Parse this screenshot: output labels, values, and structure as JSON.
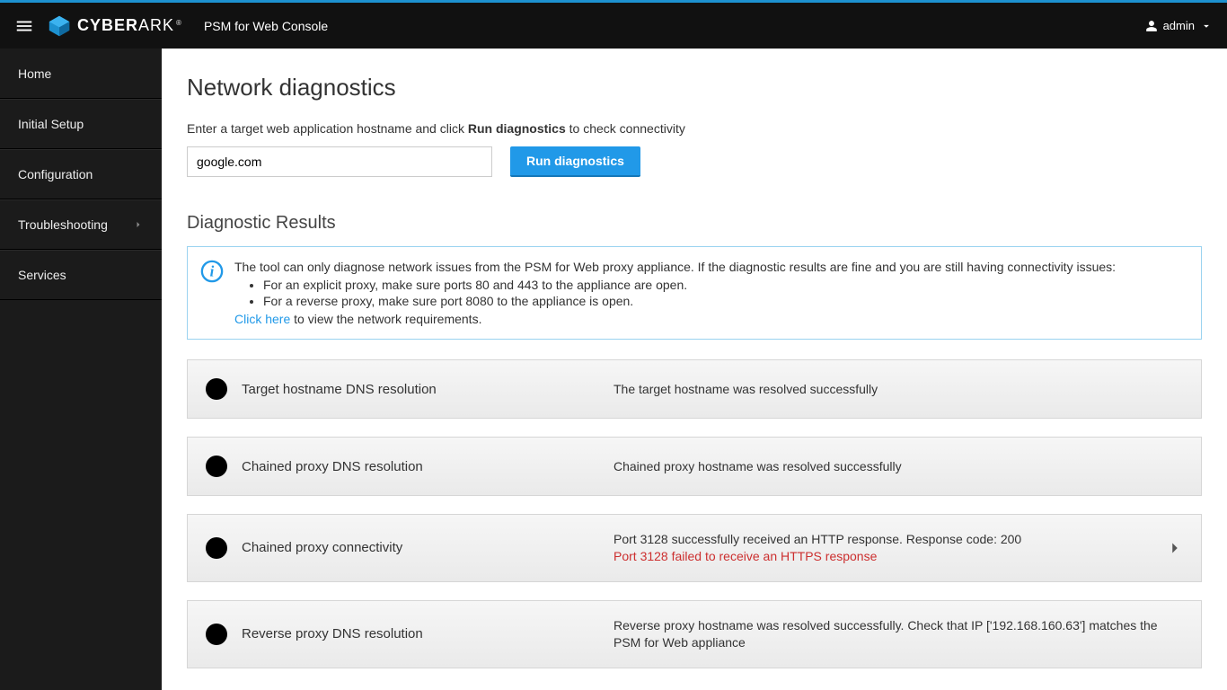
{
  "header": {
    "brand_cyber": "CYBER",
    "brand_ark": "ARK",
    "app_name": "PSM for Web Console",
    "user_label": "admin"
  },
  "sidebar": {
    "items": [
      {
        "label": "Home",
        "expandable": false
      },
      {
        "label": "Initial Setup",
        "expandable": false
      },
      {
        "label": "Configuration",
        "expandable": false
      },
      {
        "label": "Troubleshooting",
        "expandable": true
      },
      {
        "label": "Services",
        "expandable": false
      }
    ]
  },
  "page": {
    "title": "Network diagnostics",
    "instruction_pre": "Enter a target web application hostname and click ",
    "instruction_bold": "Run diagnostics",
    "instruction_post": " to check connectivity",
    "hostname_value": "google.com",
    "run_button_label": "Run diagnostics",
    "results_title": "Diagnostic Results"
  },
  "info_box": {
    "lead": "The tool can only diagnose network issues from the PSM for Web proxy appliance. If the diagnostic results are fine and you are still having connectivity issues:",
    "bullets": [
      "For an explicit proxy, make sure ports 80 and 443 to the appliance are open.",
      "For a reverse proxy, make sure port 8080 to the appliance is open."
    ],
    "link_text": "Click here",
    "link_post": " to view the network requirements."
  },
  "results": [
    {
      "status": "ok",
      "title": "Target hostname DNS resolution",
      "messages": [
        {
          "text": "The target hostname was resolved successfully",
          "error": false
        }
      ],
      "expandable": false
    },
    {
      "status": "ok",
      "title": "Chained proxy DNS resolution",
      "messages": [
        {
          "text": "Chained proxy hostname was resolved successfully",
          "error": false
        }
      ],
      "expandable": false
    },
    {
      "status": "fail",
      "title": "Chained proxy connectivity",
      "messages": [
        {
          "text": "Port 3128 successfully received an HTTP response. Response code: 200",
          "error": false
        },
        {
          "text": "Port 3128 failed to receive an HTTPS response",
          "error": true
        }
      ],
      "expandable": true
    },
    {
      "status": "ok",
      "title": "Reverse proxy DNS resolution",
      "messages": [
        {
          "text": "Reverse proxy hostname was resolved successfully. Check that IP ['192.168.160.63'] matches the PSM for Web appliance",
          "error": false
        }
      ],
      "expandable": false
    }
  ]
}
